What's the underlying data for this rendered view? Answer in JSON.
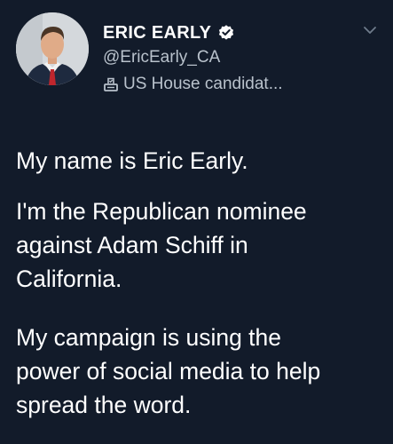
{
  "user": {
    "display_name": "ERIC EARLY",
    "handle": "@EricEarly_CA",
    "bio_label": "US House candidat...",
    "verified": true
  },
  "tweet": {
    "paragraphs": [
      "My name is Eric Early.",
      "I'm the Republican nominee\nagainst Adam Schiff in\nCalifornia.",
      "My campaign is using the\npower of social media to help\nspread the word."
    ]
  },
  "icons": {
    "verified": "verified-badge-icon",
    "ballot": "ballot-box-icon",
    "menu": "chevron-down-icon"
  },
  "colors": {
    "background": "#121b2a",
    "primary_text": "#ffffff",
    "secondary_text": "#b9c2cc"
  }
}
